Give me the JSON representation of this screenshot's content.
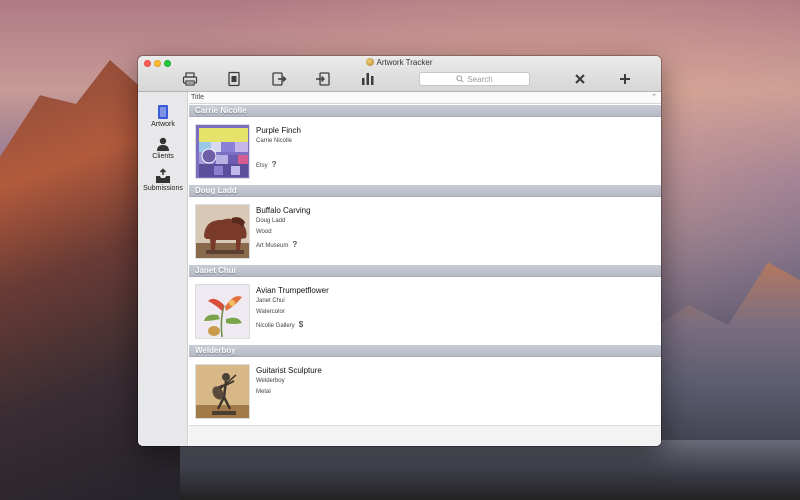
{
  "window": {
    "title": "Artwork Tracker"
  },
  "toolbar": {
    "buttons": [
      {
        "name": "print-button",
        "icon": "printer-icon"
      },
      {
        "name": "record-button",
        "icon": "document-icon"
      },
      {
        "name": "export-button",
        "icon": "export-icon"
      },
      {
        "name": "import-button",
        "icon": "import-icon"
      },
      {
        "name": "stats-button",
        "icon": "bar-chart-icon"
      },
      {
        "name": "delete-button",
        "icon": "close-icon"
      },
      {
        "name": "add-button",
        "icon": "plus-icon"
      }
    ],
    "search": {
      "placeholder": "Search"
    }
  },
  "sidebar": {
    "items": [
      {
        "label": "Artwork",
        "icon": "book-icon",
        "active": true
      },
      {
        "label": "Clients",
        "icon": "person-icon",
        "active": false
      },
      {
        "label": "Submissions",
        "icon": "inbox-upload-icon",
        "active": false
      }
    ]
  },
  "list": {
    "column_header": "Title",
    "groups": [
      {
        "header": "Carrie Nicolle",
        "item": {
          "title": "Purple Finch",
          "artist": "Carrie Nicolle",
          "medium": "",
          "venue": "Etsy",
          "status_mark": "?"
        }
      },
      {
        "header": "Doug Ladd",
        "item": {
          "title": "Buffalo Carving",
          "artist": "Doug Ladd",
          "medium": "Wood",
          "venue": "Art Museum",
          "status_mark": "?"
        }
      },
      {
        "header": "Janet Chui",
        "item": {
          "title": "Avian Trumpetflower",
          "artist": "Janet Chui",
          "medium": "Watercolor",
          "venue": "Nicolle Gallery",
          "status_mark": "$"
        }
      },
      {
        "header": "Welderboy",
        "item": {
          "title": "Guitarist Sculpture",
          "artist": "Welderboy",
          "medium": "Metal",
          "venue": "",
          "status_mark": ""
        }
      }
    ]
  }
}
